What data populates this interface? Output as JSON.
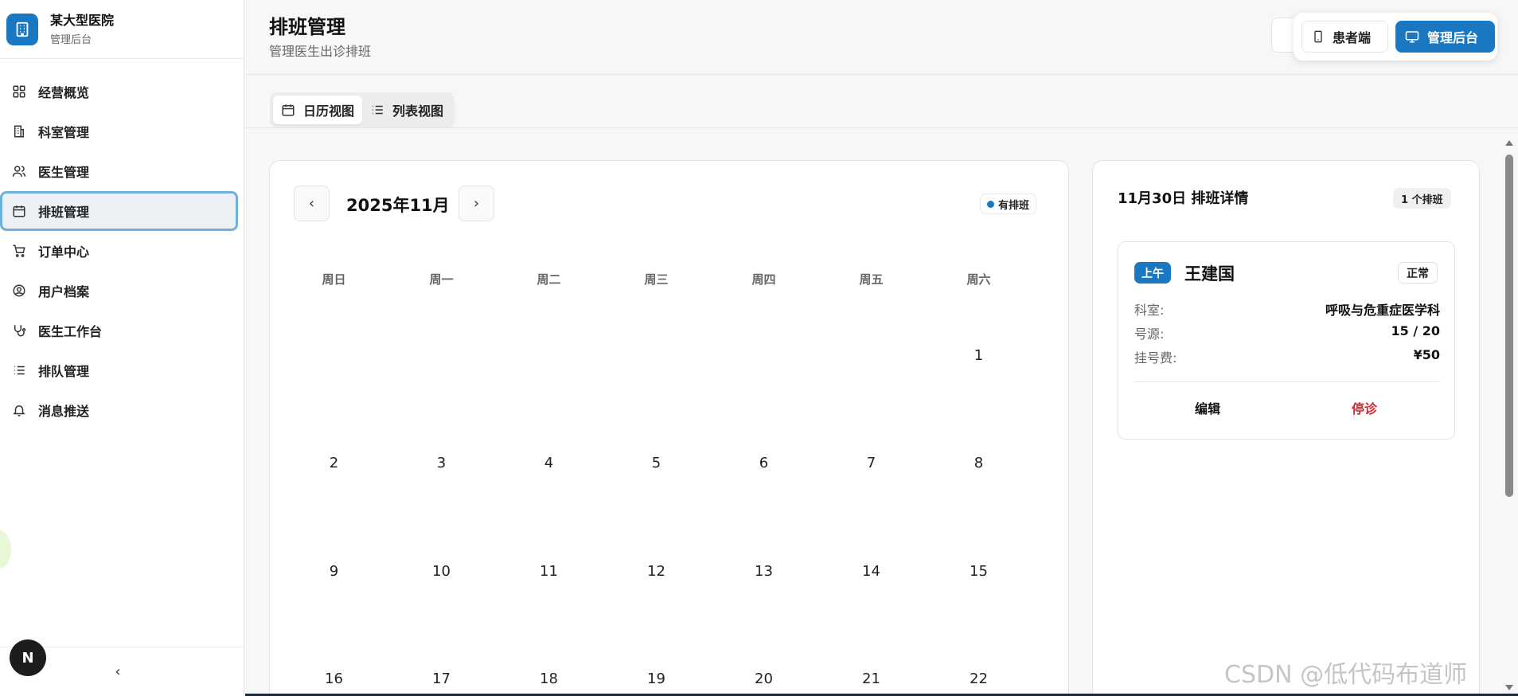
{
  "brand": {
    "name": "某大型医院",
    "subtitle": "管理后台"
  },
  "sidebar": {
    "items": [
      {
        "label": "经营概览",
        "icon": "dashboard-icon"
      },
      {
        "label": "科室管理",
        "icon": "building-icon"
      },
      {
        "label": "医生管理",
        "icon": "users-icon"
      },
      {
        "label": "排班管理",
        "icon": "calendar-icon",
        "active": true
      },
      {
        "label": "订单中心",
        "icon": "cart-icon"
      },
      {
        "label": "用户档案",
        "icon": "user-circle-icon"
      },
      {
        "label": "医生工作台",
        "icon": "stethoscope-icon"
      },
      {
        "label": "排队管理",
        "icon": "list-icon"
      },
      {
        "label": "消息推送",
        "icon": "bell-icon"
      }
    ],
    "collapse_symbol": "‹",
    "badge_letter": "N"
  },
  "header": {
    "title": "排班管理",
    "subtitle": "管理医生出诊排班",
    "switch": {
      "patient_label": "患者端",
      "admin_label": "管理后台"
    }
  },
  "view_toggle": {
    "calendar_label": "日历视图",
    "list_label": "列表视图"
  },
  "calendar": {
    "month_label": "2025年11月",
    "prev_symbol": "‹",
    "next_symbol": "›",
    "legend_label": "有排班",
    "weekdays": [
      "周日",
      "周一",
      "周二",
      "周三",
      "周四",
      "周五",
      "周六"
    ],
    "days": [
      "1",
      "2",
      "3",
      "4",
      "5",
      "6",
      "7",
      "8",
      "9",
      "10",
      "11",
      "12",
      "13",
      "14",
      "15",
      "16",
      "17",
      "18",
      "19",
      "20",
      "21",
      "22"
    ],
    "accent": "#1a78c2"
  },
  "detail": {
    "title": "11月30日 排班详情",
    "count_label": "1 个排班",
    "schedule": {
      "period": "上午",
      "doctor": "王建国",
      "status": "正常",
      "rows": [
        {
          "label": "科室:",
          "value": "呼吸与危重症医学科"
        },
        {
          "label": "号源:",
          "value": "15 / 20"
        },
        {
          "label": "挂号费:",
          "value": "¥50"
        }
      ],
      "edit_label": "编辑",
      "stop_label": "停诊",
      "stop_color": "#d9232d"
    }
  },
  "watermark": "CSDN @低代码布道师"
}
